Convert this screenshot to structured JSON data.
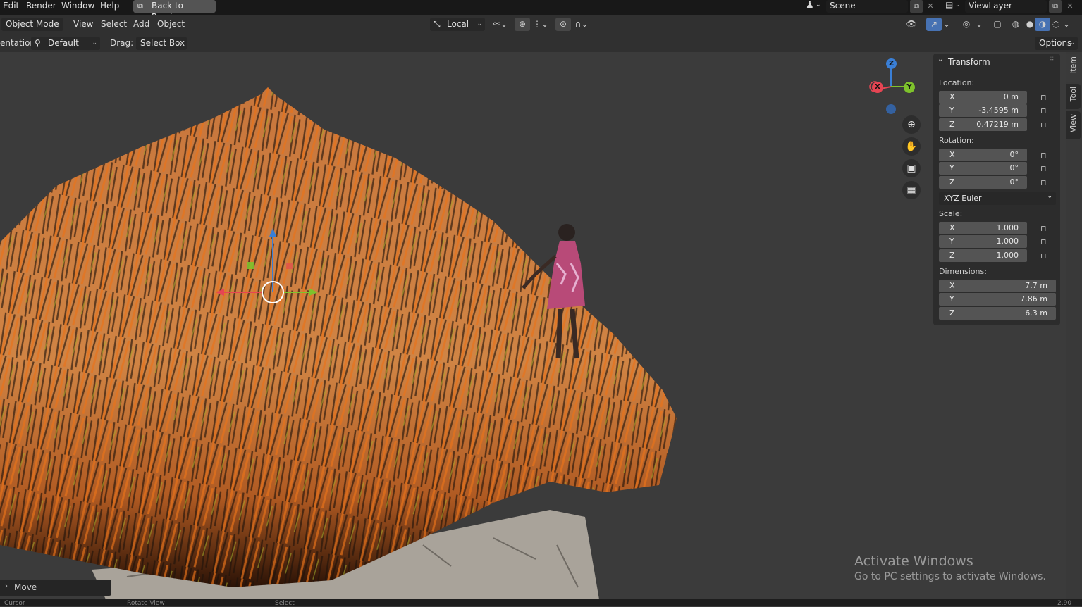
{
  "topbar": {
    "menus": [
      "Edit",
      "Render",
      "Window",
      "Help"
    ],
    "back_button": "Back to Previous",
    "scene_icon": "scene-icon",
    "scene_name": "Scene",
    "viewlayer_icon": "viewlayer-icon",
    "viewlayer_name": "ViewLayer"
  },
  "header": {
    "mode": "Object Mode",
    "menus": [
      "View",
      "Select",
      "Add",
      "Object"
    ],
    "transform_orientation": "Local"
  },
  "toolsettings": {
    "orientation_label": "entation:",
    "orientation_value": "Default",
    "drag_label": "Drag:",
    "drag_value": "Select Box",
    "options_label": "Options"
  },
  "gizmo": {
    "axes": [
      "Z",
      "X",
      "Y"
    ],
    "colors": {
      "x": "#e64553",
      "y": "#7ec22c",
      "z": "#3a7fd6"
    }
  },
  "transform_panel": {
    "title": "Transform",
    "location_label": "Location:",
    "location": [
      {
        "axis": "X",
        "value": "0 m"
      },
      {
        "axis": "Y",
        "value": "-3.4595 m"
      },
      {
        "axis": "Z",
        "value": "0.47219 m"
      }
    ],
    "rotation_label": "Rotation:",
    "rotation": [
      {
        "axis": "X",
        "value": "0°"
      },
      {
        "axis": "Y",
        "value": "0°"
      },
      {
        "axis": "Z",
        "value": "0°"
      }
    ],
    "rotation_mode": "XYZ Euler",
    "scale_label": "Scale:",
    "scale": [
      {
        "axis": "X",
        "value": "1.000"
      },
      {
        "axis": "Y",
        "value": "1.000"
      },
      {
        "axis": "Z",
        "value": "1.000"
      }
    ],
    "dimensions_label": "Dimensions:",
    "dimensions": [
      {
        "axis": "X",
        "value": "7.7 m"
      },
      {
        "axis": "Y",
        "value": "7.86 m"
      },
      {
        "axis": "Z",
        "value": "6.3 m"
      }
    ]
  },
  "side_tabs": [
    "Item",
    "Tool",
    "View"
  ],
  "watermark": {
    "title": "Activate Windows",
    "subtitle": "Go to PC settings to activate Windows."
  },
  "last_operator": "Move",
  "statusbar": {
    "items": [
      "Cursor",
      "Rotate View",
      "Select"
    ],
    "version": "2.90"
  }
}
